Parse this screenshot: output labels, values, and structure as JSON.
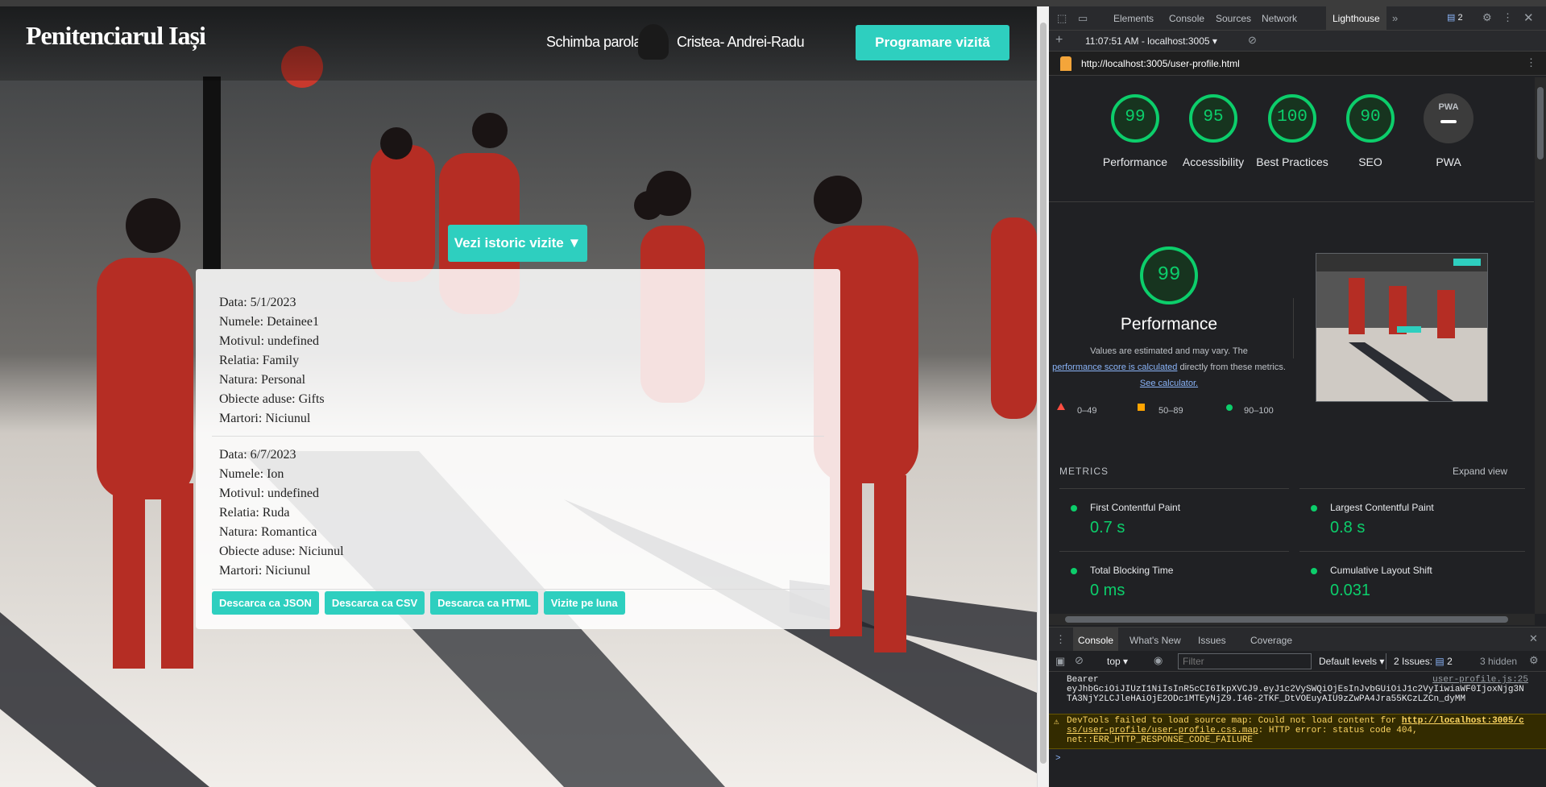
{
  "site": {
    "brand": "Penitenciarul Iași",
    "nav_change_password": "Schimba parola",
    "user_name": "Cristea- Andrei-Radu",
    "schedule_button": "Programare vizită",
    "history_button": "Vezi istoric vizite ▼",
    "visits": [
      {
        "date": "Data: 5/1/2023",
        "name": "Numele: Detainee1",
        "reason": "Motivul: undefined",
        "relation": "Relatia: Family",
        "nature": "Natura: Personal",
        "objects": "Obiecte aduse: Gifts",
        "witnesses": "Martori: Niciunul"
      },
      {
        "date": "Data: 6/7/2023",
        "name": "Numele: Ion",
        "reason": "Motivul: undefined",
        "relation": "Relatia: Ruda",
        "nature": "Natura: Romantica",
        "objects": "Obiecte aduse: Niciunul",
        "witnesses": "Martori: Niciunul"
      }
    ],
    "download_buttons": [
      "Descarca ca JSON",
      "Descarca ca CSV",
      "Descarca ca HTML",
      "Vizite pe luna"
    ],
    "accent_color": "#2ecfbf"
  },
  "devtools": {
    "tabs": [
      "Elements",
      "Console",
      "Sources",
      "Network",
      "Lighthouse"
    ],
    "active_tab": "Lighthouse",
    "issues_badge": "2",
    "report_selector": "11:07:51 AM - localhost:3005",
    "report_url": "http://localhost:3005/user-profile.html",
    "scores": [
      {
        "label": "Performance",
        "value": "99"
      },
      {
        "label": "Accessibility",
        "value": "95"
      },
      {
        "label": "Best Practices",
        "value": "100"
      },
      {
        "label": "SEO",
        "value": "90"
      },
      {
        "label": "PWA",
        "value": ""
      }
    ],
    "pwa_badge": "PWA",
    "main_score": "99",
    "main_title": "Performance",
    "estimate_text_1": "Values are estimated and may vary. The",
    "estimate_link": "performance score is calculated",
    "estimate_text_2": "directly from these metrics.",
    "calculator_link": "See calculator.",
    "legend": [
      "0–49",
      "50–89",
      "90–100"
    ],
    "metrics_title": "METRICS",
    "expand_view": "Expand view",
    "metrics": [
      {
        "label": "First Contentful Paint",
        "value": "0.7 s"
      },
      {
        "label": "Largest Contentful Paint",
        "value": "0.8 s"
      },
      {
        "label": "Total Blocking Time",
        "value": "0 ms"
      },
      {
        "label": "Cumulative Layout Shift",
        "value": "0.031"
      }
    ],
    "drawer_tabs": [
      "Console",
      "What's New",
      "Issues",
      "Coverage"
    ],
    "context": "top",
    "filter_placeholder": "Filter",
    "levels": "Default levels",
    "issues_label": "2 Issues:",
    "issues_count": "2",
    "hidden": "3 hidden",
    "log_source": "user-profile.js:25",
    "log_line1": "Bearer",
    "log_line2": "eyJhbGciOiJIUzI1NiIsInR5cCI6IkpXVCJ9.eyJ1c2VySWQiOjEsInJvbGUiOiJ1c2VyIiwiaWF0IjoxNjg3N",
    "log_line3": "TA3NjY2LCJleHAiOjE2ODc1MTEyNjZ9.I46-2TKF_DtVOEuyAIU9zZwPA4Jra55KCzLZCn_dyMM",
    "warn_line1a": "DevTools failed to load source map: Could not load content for",
    "warn_link1": "http://localhost:3005/c",
    "warn_link2": "ss/user-profile/user-profile.css.map",
    "warn_line2b": ": HTTP error: status code 404,",
    "warn_line3": "net::ERR_HTTP_RESPONSE_CODE_FAILURE",
    "prompt": ">"
  }
}
